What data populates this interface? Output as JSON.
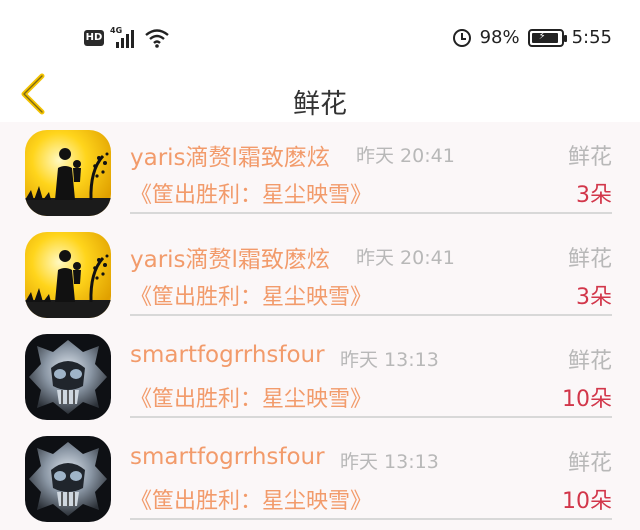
{
  "status_bar": {
    "hd_label": "HD",
    "network_label": "4G",
    "battery_percent": "98%",
    "time": "5:55"
  },
  "header": {
    "title": "鲜花"
  },
  "items": [
    {
      "user": "yaris滴赘l霜致麽炫",
      "time": "昨天 20:41",
      "kind": "鲜花",
      "book": "《筐出胜利：星尘映雪》",
      "count": "3朵",
      "avatar": "silhouette-sunset-avatar"
    },
    {
      "user": "yaris滴赘l霜致麽炫",
      "time": "昨天 20:41",
      "kind": "鲜花",
      "book": "《筐出胜利：星尘映雪》",
      "count": "3朵",
      "avatar": "silhouette-sunset-avatar"
    },
    {
      "user": "smartfogrrhsfour",
      "time": "昨天 13:13",
      "kind": "鲜花",
      "book": "《筐出胜利：星尘映雪》",
      "count": "10朵",
      "avatar": "metal-skull-avatar"
    },
    {
      "user": "smartfogrrhsfour",
      "time": "昨天 13:13",
      "kind": "鲜花",
      "book": "《筐出胜利：星尘映雪》",
      "count": "10朵",
      "avatar": "metal-skull-avatar"
    }
  ],
  "colors": {
    "accent_orange": "#f29b6b",
    "count_red": "#d2364a",
    "muted_gray": "#b8b8b8",
    "back_icon_yellow": "#f2c200"
  }
}
